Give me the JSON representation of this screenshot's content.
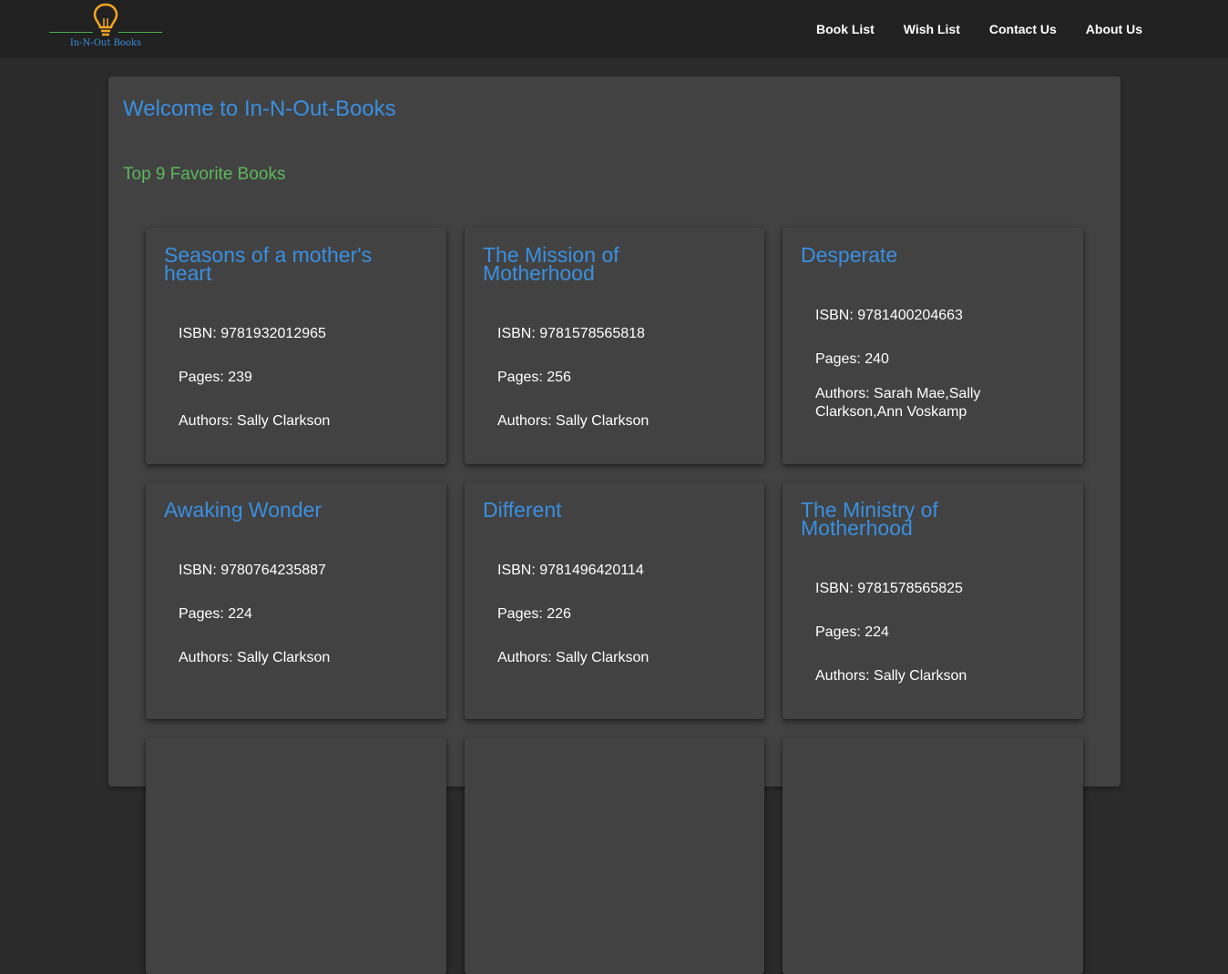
{
  "header": {
    "logo_text": "In-N-Out Books",
    "nav": [
      "Book List",
      "Wish List",
      "Contact Us",
      "About Us"
    ]
  },
  "main": {
    "welcome": "Welcome to In-N-Out-Books",
    "subtitle": "Top 9 Favorite Books",
    "books": [
      {
        "title": "Seasons of a mother's heart",
        "isbn": "ISBN: 9781932012965",
        "pages": "Pages: 239",
        "authors": "Authors: Sally Clarkson"
      },
      {
        "title": "The Mission of Motherhood",
        "isbn": "ISBN: 9781578565818",
        "pages": "Pages: 256",
        "authors": "Authors: Sally Clarkson"
      },
      {
        "title": "Desperate",
        "isbn": "ISBN: 9781400204663",
        "pages": "Pages: 240",
        "authors": "Authors: Sarah Mae,Sally Clarkson,Ann Voskamp"
      },
      {
        "title": "Awaking Wonder",
        "isbn": "ISBN: 9780764235887",
        "pages": "Pages: 224",
        "authors": "Authors: Sally Clarkson"
      },
      {
        "title": "Different",
        "isbn": "ISBN: 9781496420114",
        "pages": "Pages: 226",
        "authors": "Authors: Sally Clarkson"
      },
      {
        "title": "The Ministry of Motherhood",
        "isbn": "ISBN: 9781578565825",
        "pages": "Pages: 224",
        "authors": "Authors: Sally Clarkson"
      }
    ]
  },
  "colors": {
    "accent_blue": "#3a8fe0",
    "accent_green": "#5cb85c",
    "logo_bulb": "#f5a623"
  }
}
